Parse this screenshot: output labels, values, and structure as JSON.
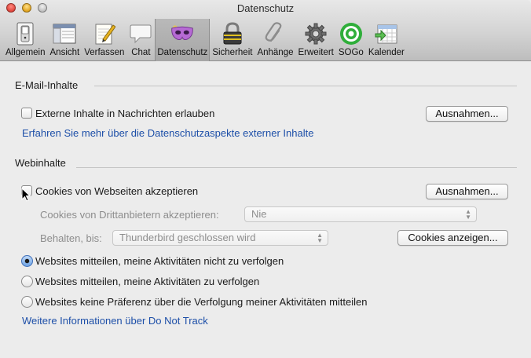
{
  "window": {
    "title": "Datenschutz"
  },
  "toolbar": {
    "items": [
      {
        "label": "Allgemein",
        "icon": "switch-icon"
      },
      {
        "label": "Ansicht",
        "icon": "window-layout-icon"
      },
      {
        "label": "Verfassen",
        "icon": "pencil-paper-icon"
      },
      {
        "label": "Chat",
        "icon": "chat-bubble-icon"
      },
      {
        "label": "Datenschutz",
        "icon": "mask-icon",
        "selected": true
      },
      {
        "label": "Sicherheit",
        "icon": "padlock-icon"
      },
      {
        "label": "Anhänge",
        "icon": "paperclip-icon"
      },
      {
        "label": "Erweitert",
        "icon": "gear-icon"
      },
      {
        "label": "SOGo",
        "icon": "sogo-target-icon"
      },
      {
        "label": "Kalender",
        "icon": "calendar-icon"
      }
    ]
  },
  "email_section": {
    "title": "E-Mail-Inhalte",
    "allow_external_label": "Externe Inhalte in Nachrichten erlauben",
    "allow_external_checked": false,
    "exceptions_button": "Ausnahmen...",
    "learn_more_link": "Erfahren Sie mehr über die Datenschutzaspekte externer Inhalte"
  },
  "web_section": {
    "title": "Webinhalte",
    "accept_cookies_label": "Cookies von Webseiten akzeptieren",
    "accept_cookies_checked": false,
    "exceptions_button": "Ausnahmen...",
    "third_party_label": "Cookies von Drittanbietern akzeptieren:",
    "third_party_value": "Nie",
    "keep_until_label": "Behalten, bis:",
    "keep_until_value": "Thunderbird geschlossen wird",
    "show_cookies_button": "Cookies anzeigen...",
    "dnt_options": [
      {
        "label": "Websites mitteilen, meine Aktivitäten nicht zu verfolgen",
        "selected": true
      },
      {
        "label": "Websites mitteilen, meine Aktivitäten zu verfolgen",
        "selected": false
      },
      {
        "label": "Websites keine Präferenz über die Verfolgung meiner Aktivitäten mitteilen",
        "selected": false
      }
    ],
    "dnt_more_link": "Weitere Informationen über Do Not Track"
  },
  "colors": {
    "link": "#1d4fa8",
    "radio_selected": "#6fa3e4",
    "sogo_green": "#2fae3a"
  }
}
